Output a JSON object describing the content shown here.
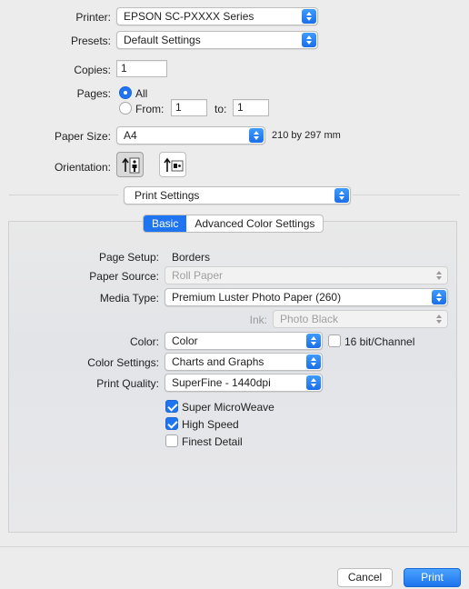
{
  "printer": {
    "label": "Printer:",
    "value": "EPSON SC-PXXXX Series"
  },
  "presets": {
    "label": "Presets:",
    "value": "Default Settings"
  },
  "copies": {
    "label": "Copies:",
    "value": "1"
  },
  "pages": {
    "label": "Pages:",
    "all_label": "All",
    "from_label": "From:",
    "from_value": "1",
    "to_label": "to:",
    "to_value": "1",
    "selected": "All"
  },
  "paper_size": {
    "label": "Paper Size:",
    "value": "A4",
    "dimensions": "210 by 297 mm"
  },
  "orientation": {
    "label": "Orientation:",
    "options": [
      "portrait",
      "landscape"
    ],
    "selected": "portrait"
  },
  "section_popup": {
    "value": "Print Settings"
  },
  "tabs": [
    {
      "label": "Basic",
      "active": true
    },
    {
      "label": "Advanced Color Settings",
      "active": false
    }
  ],
  "basic": {
    "page_setup": {
      "label": "Page Setup:",
      "value": "Borders"
    },
    "paper_source": {
      "label": "Paper Source:",
      "value": "Roll Paper",
      "enabled": false
    },
    "media_type": {
      "label": "Media Type:",
      "value": "Premium Luster Photo Paper (260)"
    },
    "ink": {
      "label": "Ink:",
      "value": "Photo Black",
      "enabled": false
    },
    "color": {
      "label": "Color:",
      "value": "Color"
    },
    "bit_channel": {
      "label": "16 bit/Channel",
      "checked": false
    },
    "color_settings": {
      "label": "Color Settings:",
      "value": "Charts and Graphs"
    },
    "print_quality": {
      "label": "Print Quality:",
      "value": "SuperFine - 1440dpi"
    },
    "super_microweave": {
      "label": "Super MicroWeave",
      "checked": true
    },
    "high_speed": {
      "label": "High Speed",
      "checked": true
    },
    "finest_detail": {
      "label": "Finest Detail",
      "checked": false
    }
  },
  "buttons": {
    "cancel": "Cancel",
    "print": "Print"
  },
  "colors": {
    "accent": "#1f75f0",
    "panel": "#e6e7ea",
    "window": "#ececec"
  }
}
